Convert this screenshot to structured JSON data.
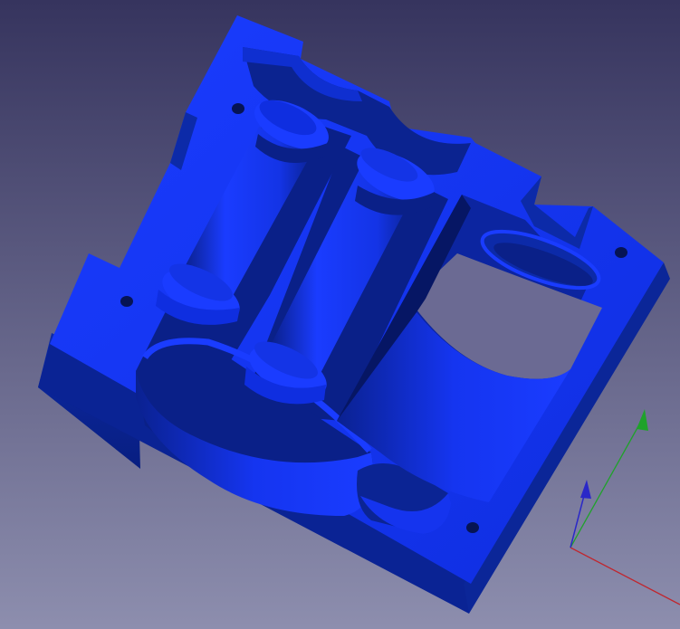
{
  "viewport": {
    "background_top": "#36345e",
    "background_bottom": "#8d8eae"
  },
  "model": {
    "part": "housing-block",
    "face_color": "#1230f0",
    "shade_color": "#0a249a",
    "dark_color": "#06135a"
  },
  "axis_triad": {
    "x_color": "#c0262e",
    "y_color": "#1fa22a",
    "z_color": "#2a28c8"
  }
}
